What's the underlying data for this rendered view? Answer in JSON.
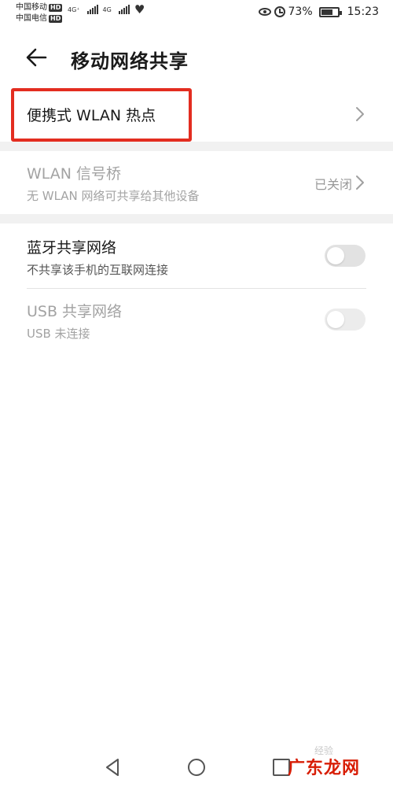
{
  "status_bar": {
    "carrier1": "中国移动",
    "carrier2": "中国电信",
    "hd_label": "HD",
    "net1": "4G⁺",
    "net2": "4G",
    "battery": "73%",
    "time": "15:23"
  },
  "header": {
    "title": "移动网络共享"
  },
  "items": {
    "hotspot": {
      "label": "便携式 WLAN 热点"
    },
    "bridge": {
      "label": "WLAN 信号桥",
      "sub": "无 WLAN 网络可共享给其他设备",
      "status": "已关闭"
    },
    "bluetooth": {
      "label": "蓝牙共享网络",
      "sub": "不共享该手机的互联网连接",
      "enabled": false
    },
    "usb": {
      "label": "USB 共享网络",
      "sub": "USB 未连接",
      "enabled": false
    }
  },
  "watermark": {
    "text": "广东龙网",
    "bg_text": "经验"
  },
  "colors": {
    "highlight": "#e32d20",
    "disabled_text": "#a3a3a3",
    "watermark": "#d81e06"
  }
}
